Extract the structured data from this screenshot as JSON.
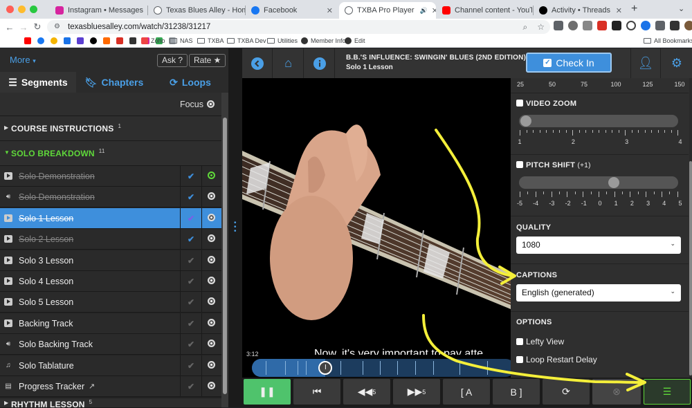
{
  "browser": {
    "tabs": [
      {
        "title": "Instagram • Messages",
        "color": "#d6249f"
      },
      {
        "title": "Texas Blues Alley - Home Fo...",
        "color": "#5f6368"
      },
      {
        "title": "Facebook",
        "color": "#1877f2"
      },
      {
        "title": "TXBA Pro Player",
        "color": "#5f6368"
      },
      {
        "title": "Channel content - YouTube S...",
        "color": "#ff0000"
      },
      {
        "title": "Activity • Threads",
        "color": "#000000"
      }
    ],
    "new_tab": "+",
    "url": "texasbluesalley.com/watch/31238/31217",
    "bookmarks": [
      "Zoho",
      "NAS",
      "TXBA",
      "TXBA Dev",
      "Utilities",
      "Member Info",
      "Edit"
    ],
    "all_bookmarks": "All Bookmarks"
  },
  "sidebar": {
    "more": "More",
    "ask": "Ask ?",
    "rate": "Rate ★",
    "tabs": [
      {
        "label": "Segments",
        "icon": "list-icon"
      },
      {
        "label": "Chapters",
        "icon": "bookmark-icon"
      },
      {
        "label": "Loops",
        "icon": "loop-icon"
      }
    ],
    "focus": "Focus",
    "sections": [
      {
        "label": "COURSE INSTRUCTIONS",
        "count": "1"
      },
      {
        "label": "SOLO BREAKDOWN",
        "count": "11"
      },
      {
        "label": "RHYTHM LESSON",
        "count": "5"
      }
    ],
    "items": [
      {
        "label": "Solo Demonstration",
        "icon": "video-icon",
        "done": true,
        "checked": true
      },
      {
        "label": "Solo Demonstration",
        "icon": "audio-icon",
        "done": true,
        "checked": true
      },
      {
        "label": "Solo 1 Lesson",
        "icon": "video-icon",
        "done": true,
        "checked": true
      },
      {
        "label": "Solo 2 Lesson",
        "icon": "video-icon",
        "done": true,
        "checked": true
      },
      {
        "label": "Solo 3 Lesson",
        "icon": "video-icon",
        "done": false,
        "checked": false
      },
      {
        "label": "Solo 4 Lesson",
        "icon": "video-icon",
        "done": false,
        "checked": false
      },
      {
        "label": "Solo 5 Lesson",
        "icon": "video-icon",
        "done": false,
        "checked": false
      },
      {
        "label": "Backing Track",
        "icon": "video-icon",
        "done": false,
        "checked": false
      },
      {
        "label": "Solo Backing Track",
        "icon": "audio-icon",
        "done": false,
        "checked": false
      },
      {
        "label": "Solo Tablature",
        "icon": "music-note-icon",
        "done": false,
        "checked": false
      },
      {
        "label": "Progress Tracker",
        "icon": "document-icon",
        "done": false,
        "checked": false
      }
    ]
  },
  "player": {
    "title": "B.B.'S INFLUENCE: SWINGIN' BLUES (2ND EDITION)",
    "subtitle": "Solo 1 Lesson",
    "check_in": "Check In",
    "caption": "Now, it's very important to pay atte",
    "time": "3:12",
    "progress": 0.28
  },
  "settings": {
    "speed_scale": [
      "25",
      "50",
      "75",
      "100",
      "125",
      "150"
    ],
    "video_zoom": {
      "label": "VIDEO ZOOM",
      "scale": [
        "1",
        "2",
        "3",
        "4"
      ],
      "value": 1
    },
    "pitch_shift": {
      "label": "PITCH SHIFT",
      "value_text": "(+1)",
      "scale": [
        "-5",
        "-4",
        "-3",
        "-2",
        "-1",
        "0",
        "1",
        "2",
        "3",
        "4",
        "5"
      ],
      "value": 1
    },
    "quality": {
      "label": "QUALITY",
      "value": "1080"
    },
    "captions": {
      "label": "CAPTIONS",
      "value": "English (generated)"
    },
    "options": {
      "label": "OPTIONS",
      "items": [
        "Lefty View",
        "Loop Restart Delay"
      ]
    }
  },
  "controls": {
    "skip_back": "5",
    "skip_fwd": "5",
    "loop_a": "[ A",
    "loop_b": "B ]"
  },
  "colors": {
    "accent": "#3e8fdc",
    "green": "#5fd83a",
    "annotation": "#f4ef3a"
  }
}
